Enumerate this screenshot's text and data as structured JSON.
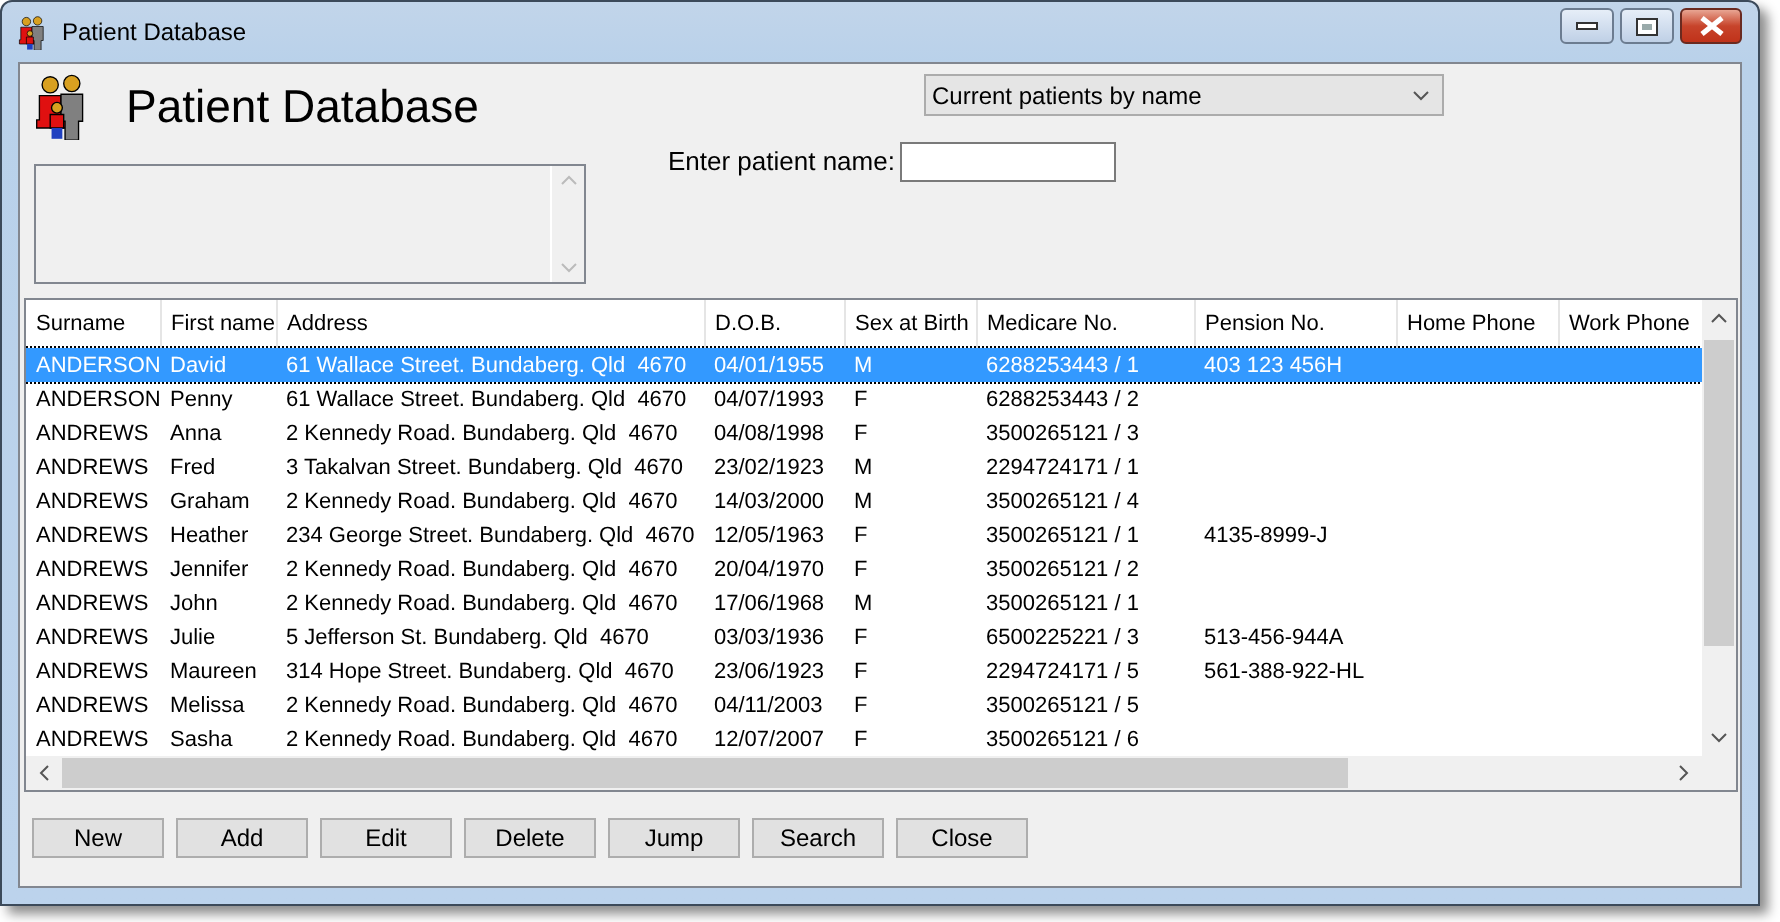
{
  "window": {
    "title": "Patient Database"
  },
  "header": {
    "title": "Patient Database"
  },
  "view_select": {
    "value": "Current patients by name"
  },
  "name_search": {
    "label": "Enter patient name:"
  },
  "table": {
    "columns": [
      "Surname",
      "First name",
      "Address",
      "D.O.B.",
      "Sex at Birth",
      "Medicare No.",
      "Pension No.",
      "Home Phone",
      "Work Phone"
    ],
    "rows": [
      {
        "surname": "ANDERSON",
        "first_name": "David",
        "address": "61 Wallace Street. Bundaberg. Qld  4670",
        "dob": "04/01/1955",
        "sex": "M",
        "medicare": "6288253443 / 1",
        "pension": "403 123 456H",
        "selected": true
      },
      {
        "surname": "ANDERSON",
        "first_name": "Penny",
        "address": "61 Wallace Street. Bundaberg. Qld  4670",
        "dob": "04/07/1993",
        "sex": "F",
        "medicare": "6288253443 / 2",
        "selected": false
      },
      {
        "surname": "ANDREWS",
        "first_name": "Anna",
        "address": "2 Kennedy Road. Bundaberg. Qld  4670",
        "dob": "04/08/1998",
        "sex": "F",
        "medicare": "3500265121 / 3",
        "selected": false
      },
      {
        "surname": "ANDREWS",
        "first_name": "Fred",
        "address": "3 Takalvan Street. Bundaberg. Qld  4670",
        "dob": "23/02/1923",
        "sex": "M",
        "medicare": "2294724171 / 1",
        "selected": false
      },
      {
        "surname": "ANDREWS",
        "first_name": "Graham",
        "address": "2 Kennedy Road. Bundaberg. Qld  4670",
        "dob": "14/03/2000",
        "sex": "M",
        "medicare": "3500265121 / 4",
        "selected": false
      },
      {
        "surname": "ANDREWS",
        "first_name": "Heather",
        "address": "234 George Street. Bundaberg. Qld  4670",
        "dob": "12/05/1963",
        "sex": "F",
        "medicare": "3500265121 / 1",
        "pension": "4135-8999-J",
        "selected": false
      },
      {
        "surname": "ANDREWS",
        "first_name": "Jennifer",
        "address": "2 Kennedy Road. Bundaberg. Qld  4670",
        "dob": "20/04/1970",
        "sex": "F",
        "medicare": "3500265121 / 2",
        "selected": false
      },
      {
        "surname": "ANDREWS",
        "first_name": "John",
        "address": "2 Kennedy Road. Bundaberg. Qld  4670",
        "dob": "17/06/1968",
        "sex": "M",
        "medicare": "3500265121 / 1",
        "selected": false
      },
      {
        "surname": "ANDREWS",
        "first_name": "Julie",
        "address": "5 Jefferson St. Bundaberg. Qld  4670",
        "dob": "03/03/1936",
        "sex": "F",
        "medicare": "6500225221 / 3",
        "pension": "513-456-944A",
        "selected": false
      },
      {
        "surname": "ANDREWS",
        "first_name": "Maureen",
        "address": "314 Hope Street. Bundaberg. Qld  4670",
        "dob": "23/06/1923",
        "sex": "F",
        "medicare": "2294724171 / 5",
        "pension": "561-388-922-HL",
        "selected": false
      },
      {
        "surname": "ANDREWS",
        "first_name": "Melissa",
        "address": "2 Kennedy Road. Bundaberg. Qld  4670",
        "dob": "04/11/2003",
        "sex": "F",
        "medicare": "3500265121 / 5",
        "selected": false
      },
      {
        "surname": "ANDREWS",
        "first_name": "Sasha",
        "address": "2 Kennedy Road. Bundaberg. Qld  4670",
        "dob": "12/07/2007",
        "sex": "F",
        "medicare": "3500265121 / 6",
        "selected": false
      }
    ]
  },
  "buttons": [
    {
      "label": "New"
    },
    {
      "label": "Add"
    },
    {
      "label": "Edit"
    },
    {
      "label": "Delete"
    },
    {
      "label": "Jump"
    },
    {
      "label": "Search"
    },
    {
      "label": "Close"
    }
  ]
}
